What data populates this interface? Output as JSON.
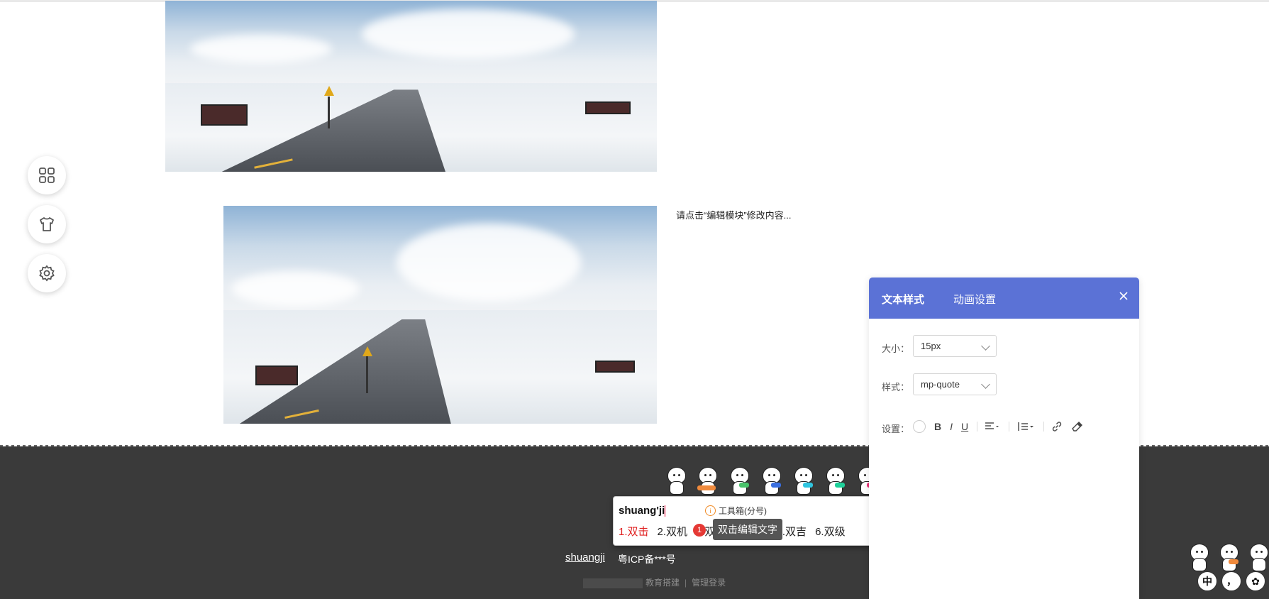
{
  "content": {
    "hint_text": "请点击“编辑模块”修改内容..."
  },
  "side_tools": {
    "items": [
      {
        "icon": "apps-grid-icon"
      },
      {
        "icon": "tshirt-icon"
      },
      {
        "icon": "gear-icon"
      }
    ]
  },
  "footer": {
    "icp": "粤ICP备***号",
    "link_partial": "教育搭建",
    "admin_link": "管理登录",
    "separator": "|",
    "typed_word": "shuangji"
  },
  "ime": {
    "composition": "shuang'ji",
    "toolbox_label": "工具箱(分号)",
    "candidates": [
      "1.双击",
      "2.双机",
      "3.双",
      "5.双吉",
      "6.双级"
    ],
    "more_icon": "▾",
    "tooltip": "双击编辑文字",
    "badge": "1"
  },
  "panel": {
    "tabs": [
      "文本样式",
      "动画设置"
    ],
    "size_label": "大小：",
    "size_value": "15px",
    "style_label": "样式：",
    "style_value": "mp-quote",
    "settings_label": "设置：",
    "tools": {
      "bold": "B",
      "italic": "I",
      "underline": "U"
    },
    "accent_color": "#5b72d6"
  },
  "corner_ime": {
    "lang": "中",
    "punct": "，"
  }
}
